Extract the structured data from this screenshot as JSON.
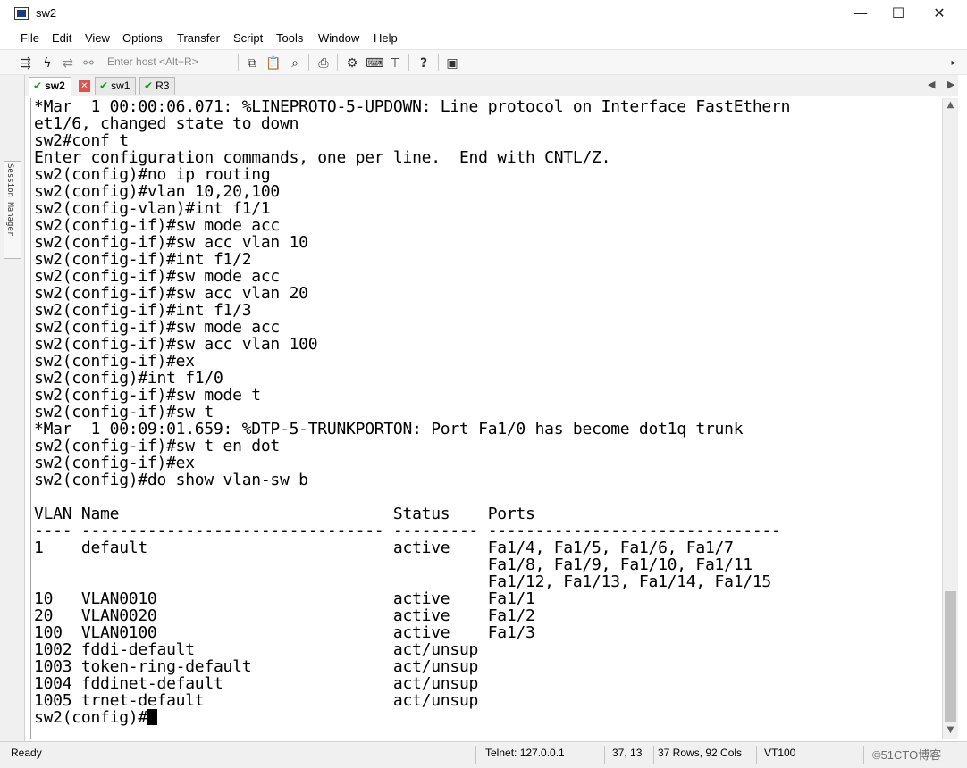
{
  "window": {
    "title": "sw2",
    "minimize": "—",
    "maximize": "☐",
    "close": "✕"
  },
  "menu": [
    "File",
    "Edit",
    "View",
    "Options",
    "Transfer",
    "Script",
    "Tools",
    "Window",
    "Help"
  ],
  "toolbar": {
    "host_placeholder": "Enter host <Alt+R>"
  },
  "session_manager": {
    "label": "Session Manager"
  },
  "tabs": [
    {
      "label": "sw2",
      "active": true,
      "status": "connected"
    },
    {
      "label": "sw1",
      "active": false,
      "status": "connected"
    },
    {
      "label": "R3",
      "active": false,
      "status": "connected"
    }
  ],
  "terminal": {
    "lines": [
      "*Mar  1 00:00:06.071: %LINEPROTO-5-UPDOWN: Line protocol on Interface FastEthern",
      "et1/6, changed state to down",
      "sw2#conf t",
      "Enter configuration commands, one per line.  End with CNTL/Z.",
      "sw2(config)#no ip routing",
      "sw2(config)#vlan 10,20,100",
      "sw2(config-vlan)#int f1/1",
      "sw2(config-if)#sw mode acc",
      "sw2(config-if)#sw acc vlan 10",
      "sw2(config-if)#int f1/2",
      "sw2(config-if)#sw mode acc",
      "sw2(config-if)#sw acc vlan 20",
      "sw2(config-if)#int f1/3",
      "sw2(config-if)#sw mode acc",
      "sw2(config-if)#sw acc vlan 100",
      "sw2(config-if)#ex",
      "sw2(config)#int f1/0",
      "sw2(config-if)#sw mode t",
      "sw2(config-if)#sw t",
      "*Mar  1 00:09:01.659: %DTP-5-TRUNKPORTON: Port Fa1/0 has become dot1q trunk",
      "sw2(config-if)#sw t en dot",
      "sw2(config-if)#ex",
      "sw2(config)#do show vlan-sw b",
      "",
      "VLAN Name                             Status    Ports",
      "---- -------------------------------- --------- -------------------------------",
      "1    default                          active    Fa1/4, Fa1/5, Fa1/6, Fa1/7",
      "                                                Fa1/8, Fa1/9, Fa1/10, Fa1/11",
      "                                                Fa1/12, Fa1/13, Fa1/14, Fa1/15",
      "10   VLAN0010                         active    Fa1/1",
      "20   VLAN0020                         active    Fa1/2",
      "100  VLAN0100                         active    Fa1/3",
      "1002 fddi-default                     act/unsup",
      "1003 token-ring-default               act/unsup",
      "1004 fddinet-default                  act/unsup",
      "1005 trnet-default                    act/unsup"
    ],
    "prompt": "sw2(config)#"
  },
  "status": {
    "ready": "Ready",
    "connection": "Telnet: 127.0.0.1",
    "cursor_pos": "37,  13",
    "size": "37 Rows, 92 Cols",
    "emulation": "VT100",
    "watermark": "©51CTO博客"
  }
}
